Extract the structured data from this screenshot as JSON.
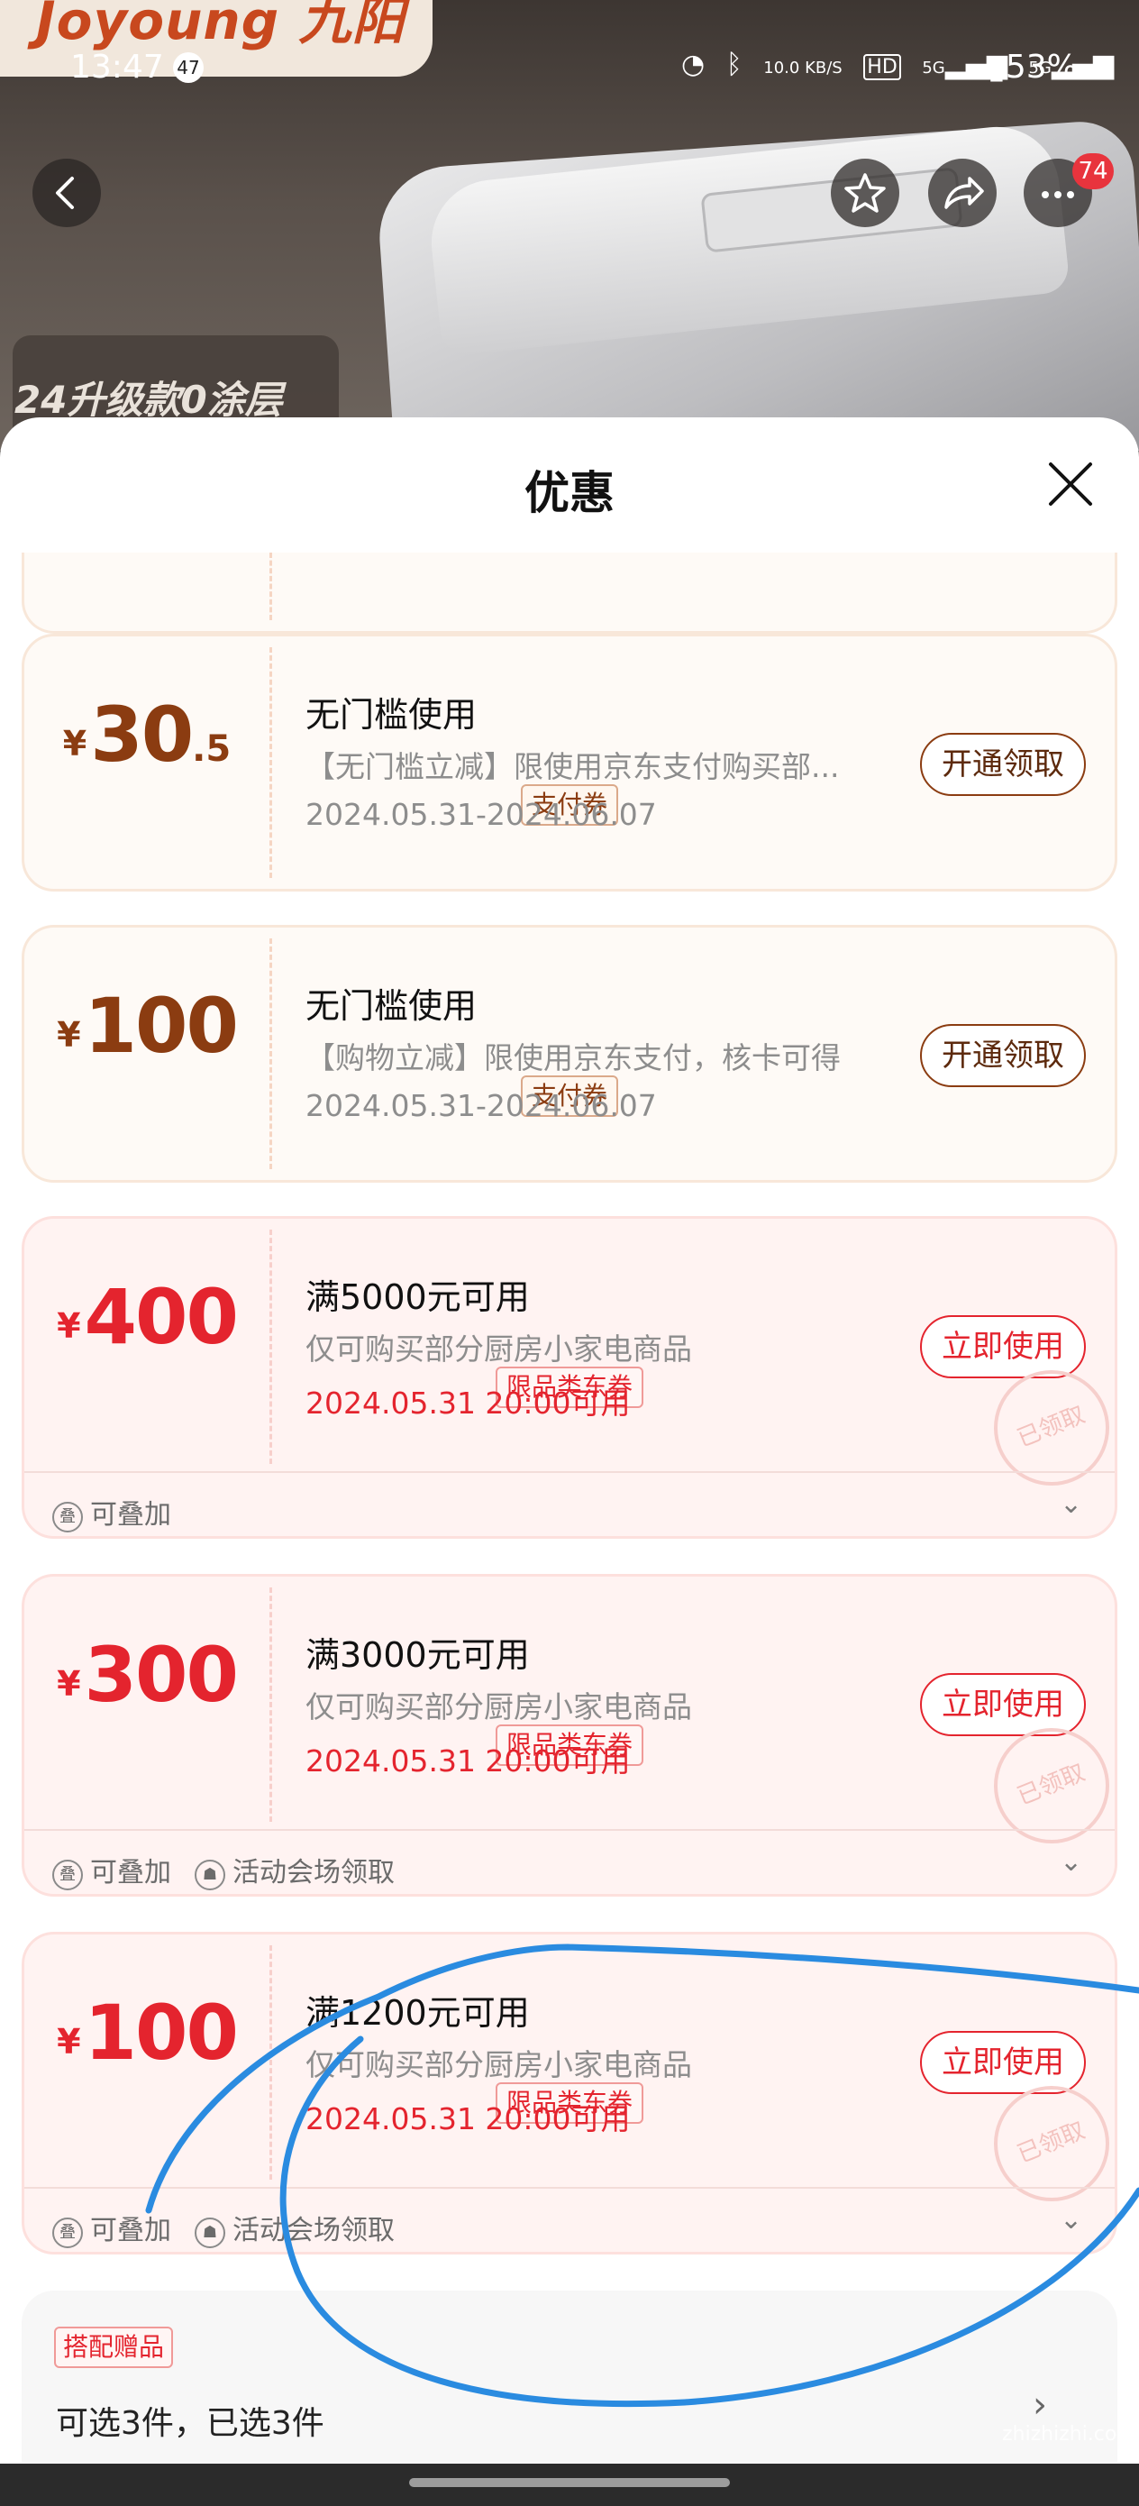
{
  "background": {
    "brand": "Joyoung 九阳",
    "promo_label": "24升级款0涂层"
  },
  "status_bar": {
    "time": "13:47",
    "notification_count": "47",
    "net_speed": "10.0 KB/S",
    "signal": [
      "HD",
      "5G",
      "5G"
    ],
    "battery": "53%"
  },
  "nav": {
    "badge_count": "74"
  },
  "sheet": {
    "title": "优惠"
  },
  "coupons": [
    {
      "style": "gold",
      "yen": "¥",
      "amount_int": "30",
      "amount_dec": ".5",
      "tag": "支付券",
      "title": "无门槛使用",
      "desc": "【无门槛立减】限使用京东支付购买部...",
      "date": "2024.05.31-2024.06.07",
      "button": "开通领取"
    },
    {
      "style": "gold",
      "yen": "¥",
      "amount_int": "100",
      "amount_dec": "",
      "tag": "支付券",
      "title": "无门槛使用",
      "desc": "【购物立减】限使用京东支付，核卡可得",
      "date": "2024.05.31-2024.06.07",
      "button": "开通领取"
    },
    {
      "style": "red",
      "yen": "¥",
      "amount_int": "400",
      "amount_dec": "",
      "tag": "限品类东券",
      "title": "满5000元可用",
      "desc": "仅可购买部分厨房小家电商品",
      "date": "2024.05.31 20:00可用",
      "button": "立即使用",
      "stamp": "已领取",
      "footer": [
        "可叠加"
      ]
    },
    {
      "style": "red",
      "yen": "¥",
      "amount_int": "300",
      "amount_dec": "",
      "tag": "限品类东券",
      "title": "满3000元可用",
      "desc": "仅可购买部分厨房小家电商品",
      "date": "2024.05.31 20:00可用",
      "button": "立即使用",
      "stamp": "已领取",
      "footer": [
        "可叠加",
        "活动会场领取"
      ]
    },
    {
      "style": "red",
      "yen": "¥",
      "amount_int": "100",
      "amount_dec": "",
      "tag": "限品类东券",
      "title": "满1200元可用",
      "desc": "仅可购买部分厨房小家电商品",
      "date": "2024.05.31 20:00可用",
      "button": "立即使用",
      "stamp": "已领取",
      "footer": [
        "可叠加",
        "活动会场领取"
      ]
    }
  ],
  "gift": {
    "tag": "搭配赠品",
    "text": "可选3件，已选3件"
  },
  "watermark": "zhizhizhi.com",
  "colors": {
    "gold_text": "#8b3c11",
    "red_accent": "#e4242e",
    "annotation_stroke": "#2a8be0"
  }
}
